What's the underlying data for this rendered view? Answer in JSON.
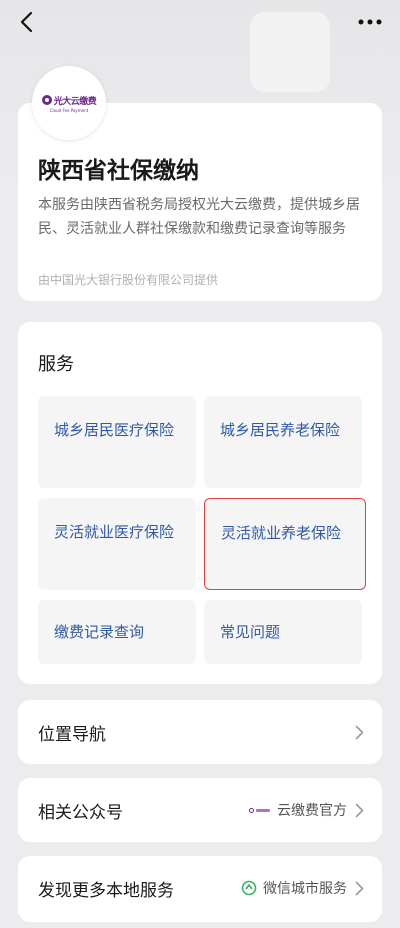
{
  "nav": {
    "back_icon": "back-chevron-icon",
    "more_icon": "more-dots-icon"
  },
  "logo": {
    "cn": "光大云缴费",
    "en": "Cloud Fee Payment"
  },
  "info": {
    "title": "陕西省社保缴纳",
    "description": "本服务由陕西省税务局授权光大云缴费，提供城乡居民、灵活就业人群社保缴款和缴费记录查询等服务",
    "provider": "由中国光大银行股份有限公司提供"
  },
  "services": {
    "title": "服务",
    "items": [
      {
        "label": "城乡居民医疗保险"
      },
      {
        "label": "城乡居民养老保险"
      },
      {
        "label": "灵活就业医疗保险"
      },
      {
        "label": "灵活就业养老保险"
      },
      {
        "label": "缴费记录查询"
      },
      {
        "label": "常见问题"
      }
    ]
  },
  "rows": {
    "location": {
      "label": "位置导航"
    },
    "official": {
      "label": "相关公众号",
      "value": "云缴费官方"
    },
    "discover": {
      "label": "发现更多本地服务",
      "value": "微信城市服务"
    }
  },
  "colors": {
    "link": "#2f5aa8",
    "highlight": "#e0453c",
    "brand": "#6b2a8a"
  }
}
